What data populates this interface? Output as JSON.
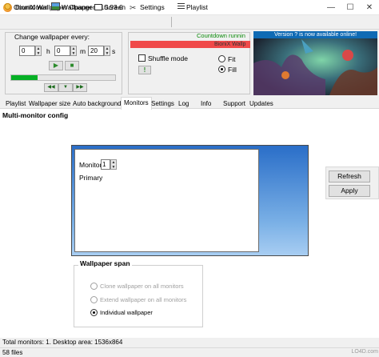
{
  "window": {
    "title": "BioniX Wallpaper Changer v10.93.0",
    "controls": [
      "—",
      "☐",
      "✕"
    ]
  },
  "toolbar": {
    "items": [
      {
        "label": "Countdown",
        "icon": "countdown-icon"
      },
      {
        "label": "Wallpaper",
        "icon": "wallpaper-icon"
      },
      {
        "label": "Screen",
        "icon": "screen-icon"
      },
      {
        "label": "Settings",
        "icon": "settings-icon"
      },
      {
        "label": "Playlist",
        "icon": "playlist-icon"
      }
    ]
  },
  "countdown": {
    "group_label": "Change wallpaper every:",
    "hours": "0",
    "minutes": "0",
    "seconds": "20",
    "unit_h": "h",
    "unit_m": "m",
    "unit_s": "s",
    "progress": 0.25,
    "play_symbol": "▶",
    "stop_symbol": "■",
    "prev_symbol": "◀◀",
    "down_symbol": "▼",
    "next_symbol": "▶▶"
  },
  "middle": {
    "countdown_status": "Countdown runnin",
    "bar_text": "BioniX Wallp",
    "shuffle_label": "Shuffle mode",
    "fit_label": "Fit",
    "fill_label": "Fill",
    "fill_selected": true,
    "info_symbol": "!"
  },
  "preview": {
    "banner": "Version ? is now available online!"
  },
  "tabs": [
    {
      "label": "Playlist"
    },
    {
      "label": "Wallpaper size"
    },
    {
      "label": "Auto background"
    },
    {
      "label": "Monitors",
      "active": true
    },
    {
      "label": "Settings"
    },
    {
      "label": "Log"
    },
    {
      "label": "Info"
    },
    {
      "label": "Support"
    },
    {
      "label": "Updates"
    }
  ],
  "monitors": {
    "section_title": "Multi-monitor config",
    "monitor_label": "Monitor",
    "monitor_value": "1",
    "primary_label": "Primary",
    "refresh_label": "Refresh",
    "apply_label": "Apply",
    "span": {
      "title": "Wallpaper span",
      "options": [
        {
          "label": "Clone wallpaper on all monitors",
          "enabled": false
        },
        {
          "label": "Extend wallpaper on all monitors",
          "enabled": false
        },
        {
          "label": "Individual wallpaper",
          "enabled": true,
          "selected": true
        }
      ]
    },
    "status": "Total monitors: 1.   Desktop area: 1536x864"
  },
  "statusbar": {
    "files": "58 files",
    "watermark": "LO4D.com"
  }
}
